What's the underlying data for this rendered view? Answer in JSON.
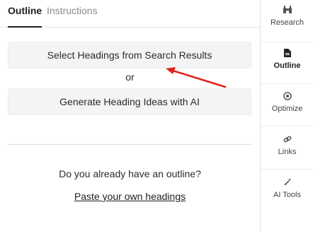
{
  "tabs": {
    "outline_label": "Outline",
    "instructions_label": "Instructions"
  },
  "main": {
    "select_button_label": "Select Headings from Search Results",
    "or_text": "or",
    "generate_button_label": "Generate Heading Ideas with AI",
    "question_text": "Do you already have an outline?",
    "paste_link_label": "Paste your own headings"
  },
  "sidebar": {
    "items": [
      {
        "label": "Research",
        "icon": "binoculars-icon",
        "active": false
      },
      {
        "label": "Outline",
        "icon": "document-icon",
        "active": true
      },
      {
        "label": "Optimize",
        "icon": "target-icon",
        "active": false
      },
      {
        "label": "Links",
        "icon": "link-icon",
        "active": false
      },
      {
        "label": "AI Tools",
        "icon": "magic-wand-icon",
        "active": false
      }
    ]
  },
  "colors": {
    "annotation_arrow": "#e0201b",
    "button_bg": "#f3f4f6"
  }
}
